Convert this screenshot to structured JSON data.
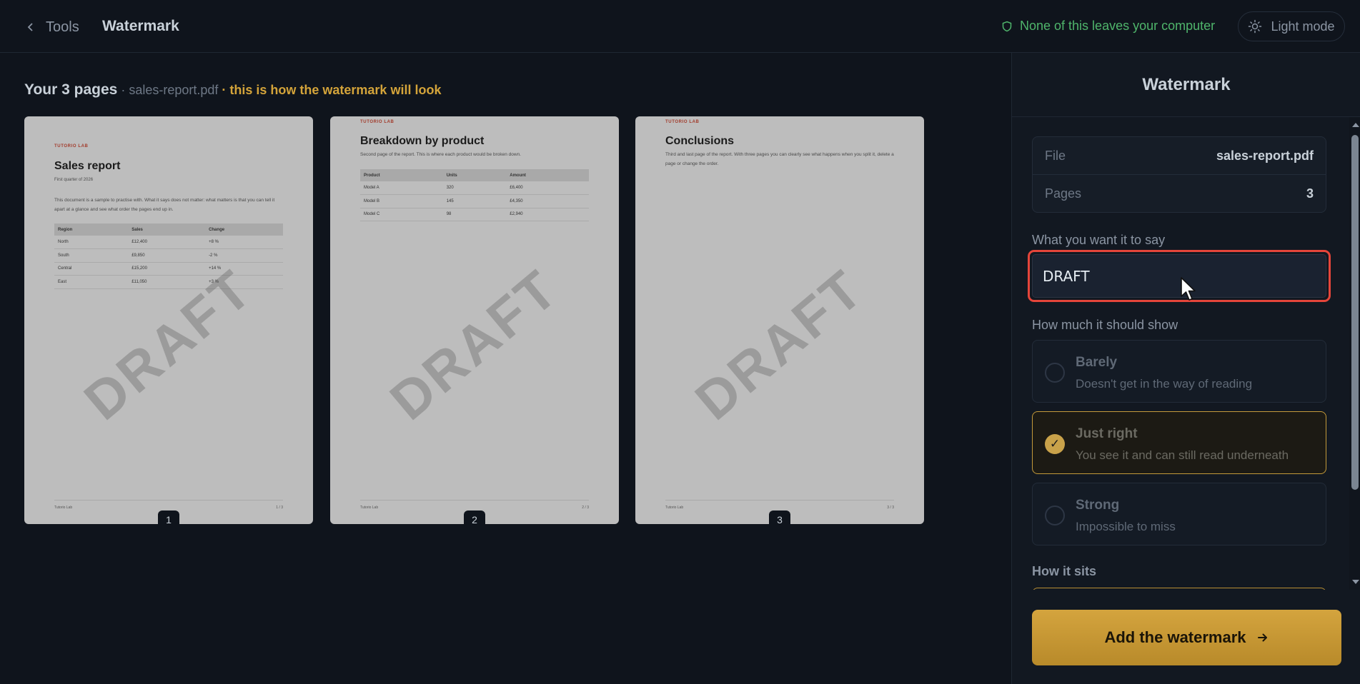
{
  "topbar": {
    "back_label": "Tools",
    "title": "Watermark",
    "privacy_text": "None of this leaves your computer",
    "mode_label": "Light mode"
  },
  "main": {
    "heading_strong": "Your 3 pages",
    "heading_file": " · sales-report.pdf ",
    "heading_hint": "· this is how the watermark will look"
  },
  "pages": [
    {
      "number": "1",
      "brand": "TUTORIO LAB",
      "title": "Sales report",
      "subtitle": "First quarter of 2026",
      "paragraph": "This document is a sample to practise with. What it says does not matter: what matters is that you can tell it apart at a glance and see what order the pages end up in.",
      "table_headers": [
        "Region",
        "Sales",
        "Change"
      ],
      "table_rows": [
        [
          "North",
          "£12,400",
          "+8 %"
        ],
        [
          "South",
          "£9,850",
          "-2 %"
        ],
        [
          "Central",
          "£15,200",
          "+14 %"
        ],
        [
          "East",
          "£11,050",
          "+3 %"
        ]
      ],
      "footer_left": "Tutorio Lab",
      "footer_right": "1 / 3",
      "watermark": "DRAFT"
    },
    {
      "number": "2",
      "brand": "TUTORIO LAB",
      "title": "Breakdown by product",
      "paragraph": "Second page of the report. This is where each product would be broken down.",
      "table_headers": [
        "Product",
        "Units",
        "Amount"
      ],
      "table_rows": [
        [
          "Model A",
          "320",
          "£6,400"
        ],
        [
          "Model B",
          "145",
          "£4,350"
        ],
        [
          "Model C",
          "98",
          "£2,940"
        ]
      ],
      "footer_left": "Tutorio Lab",
      "footer_right": "2 / 3",
      "watermark": "DRAFT"
    },
    {
      "number": "3",
      "brand": "TUTORIO LAB",
      "title": "Conclusions",
      "paragraph": "Third and last page of the report. With three pages you can clearly see what happens when you split it, delete a page or change the order.",
      "footer_left": "Tutorio Lab",
      "footer_right": "3 / 3",
      "watermark": "DRAFT"
    }
  ],
  "panel": {
    "title": "Watermark",
    "file_label": "File",
    "file_value": "sales-report.pdf",
    "pages_label": "Pages",
    "pages_value": "3",
    "text_label": "What you want it to say",
    "text_value": "DRAFT",
    "strength_label": "How much it should show",
    "options": [
      {
        "title": "Barely",
        "desc": "Doesn't get in the way of reading",
        "selected": false
      },
      {
        "title": "Just right",
        "desc": "You see it and can still read underneath",
        "selected": true
      },
      {
        "title": "Strong",
        "desc": "Impossible to miss",
        "selected": false
      }
    ],
    "position_label": "How it sits",
    "cta_label": "Add the watermark"
  },
  "colors": {
    "background": "#0f141c",
    "accent": "#d4a43e",
    "focus_ring": "#e5453a",
    "privacy_green": "#4fb56b"
  },
  "icons": {
    "back": "chevron-left-icon",
    "privacy": "shield-icon",
    "mode": "sun-icon",
    "cta": "arrow-right-icon",
    "check": "check-icon"
  }
}
